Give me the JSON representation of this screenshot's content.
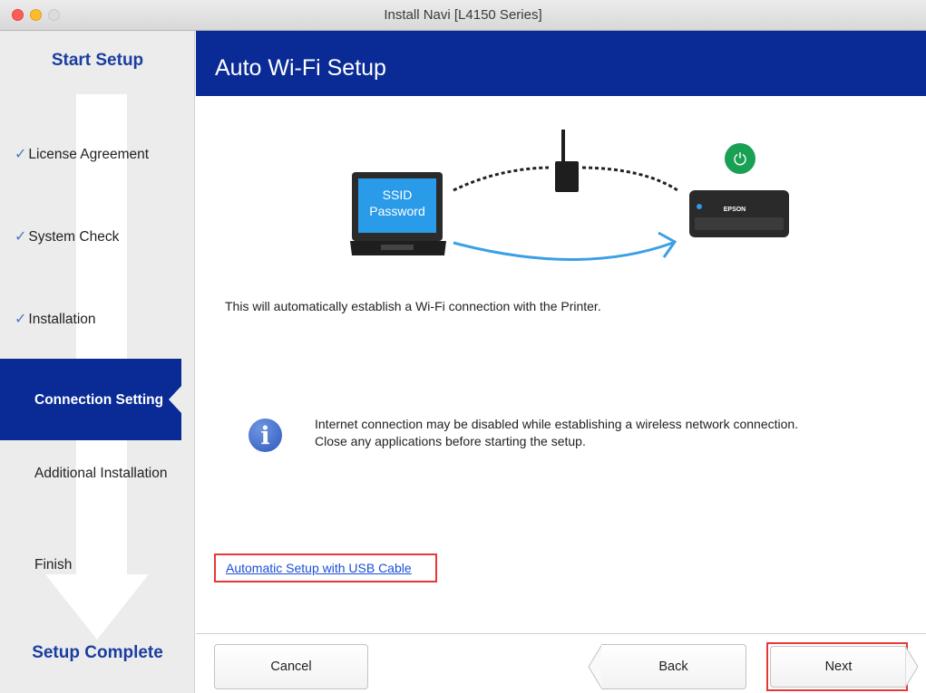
{
  "window": {
    "title": "Install Navi [L4150 Series]"
  },
  "sidebar": {
    "start_label": "Start Setup",
    "end_label": "Setup Complete",
    "steps": [
      {
        "label": "License Agreement",
        "done": true
      },
      {
        "label": "System Check",
        "done": true
      },
      {
        "label": "Installation",
        "done": true
      },
      {
        "label": "Connection Setting",
        "active": true
      },
      {
        "label": "Additional Installation"
      },
      {
        "label": "Finish"
      }
    ],
    "check_glyph": "✓"
  },
  "header": {
    "title": "Auto Wi-Fi Setup"
  },
  "illustration": {
    "screen_line1": "SSID",
    "screen_line2": "Password",
    "printer_brand": "EPSON",
    "power_glyph": "⏻"
  },
  "main": {
    "description": "This will automatically establish a Wi-Fi connection with the Printer.",
    "notice_line1": "Internet connection may be disabled while establishing a wireless network connection.",
    "notice_line2": "Close any applications before starting the setup.",
    "info_glyph": "i",
    "usb_link": "Automatic Setup with USB Cable"
  },
  "footer": {
    "cancel_label": "Cancel",
    "back_label": "Back",
    "next_label": "Next"
  },
  "colors": {
    "header_blue": "#0a2b96",
    "sidebar_active_blue": "#0a2b96",
    "link_blue": "#1a4fd6",
    "highlight_red": "#e53935",
    "power_green": "#1aa055"
  }
}
